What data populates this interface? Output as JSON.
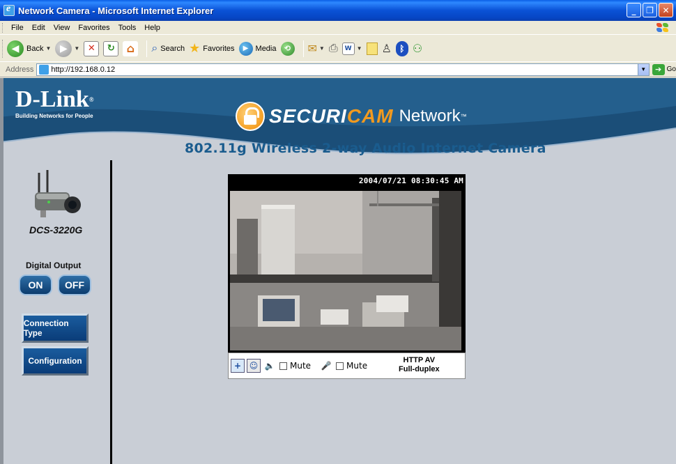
{
  "window": {
    "title": "Network Camera - Microsoft Internet Explorer"
  },
  "menu": [
    "File",
    "Edit",
    "View",
    "Favorites",
    "Tools",
    "Help"
  ],
  "toolbar": {
    "back": "Back",
    "search": "Search",
    "favorites": "Favorites",
    "media": "Media"
  },
  "address": {
    "label": "Address",
    "url": "http://192.168.0.12",
    "go": "Go"
  },
  "banner": {
    "brand": "D-Link",
    "tagline": "Building Networks for People",
    "product_line_1": "SECURI",
    "product_line_2": "CAM",
    "product_line_3": "Network",
    "tm": "™",
    "subtitle": "802.11g Wireless 2-way Audio Internet Camera"
  },
  "sidebar": {
    "model": "DCS-3220G",
    "digital_output_label": "Digital Output",
    "on": "ON",
    "off": "OFF",
    "connection_type": "Connection Type",
    "configuration": "Configuration"
  },
  "video": {
    "timestamp": "2004/07/21 08:30:45 AM",
    "mute1": "Mute",
    "mute2": "Mute",
    "protocol": "HTTP  AV",
    "duplex": "Full-duplex"
  },
  "colors": {
    "banner_dark": "#1B4E78",
    "banner_mid": "#2C6E9E",
    "page_bg": "#C9CED6",
    "accent_orange": "#F29A1F",
    "subtitle_blue": "#1A5C8E"
  }
}
